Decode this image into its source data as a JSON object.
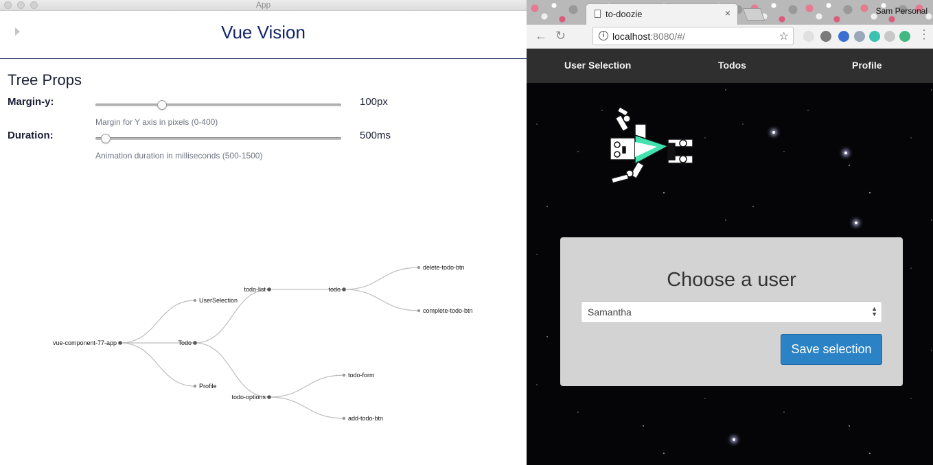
{
  "left_window": {
    "title": "App",
    "app_title": "Vue Vision",
    "section_title": "Tree Props",
    "props": [
      {
        "label": "Margin-y:",
        "value": "100px",
        "help": "Margin for Y axis in pixels (0-400)",
        "slider_fraction": 0.25
      },
      {
        "label": "Duration:",
        "value": "500ms",
        "help": "Animation duration in milliseconds (500-1500)",
        "slider_fraction": 0.0
      }
    ],
    "tree_nodes": {
      "root": "vue-component-77-app",
      "user_selection": "UserSelection",
      "todo": "Todo",
      "profile": "Profile",
      "todo_list": "todo-list",
      "todo_options": "todo-options",
      "todo_item": "todo",
      "delete_btn": "delete-todo-btn",
      "complete_btn": "complete-todo-btn",
      "todo_form": "todo-form",
      "add_btn": "add-todo-btn"
    }
  },
  "browser": {
    "tab_title": "to-doozie",
    "tab_close": "×",
    "profile_name": "Sam Personal",
    "url_host": "localhost",
    "url_rest": ":8080/#/",
    "nav_back": "←",
    "nav_reload": "↻",
    "star": "☆",
    "info": "i",
    "extension_colors": [
      "#e0e0e0",
      "#7a7a7a",
      "#3b6fd1",
      "#9aa7b8",
      "#39c2b0",
      "#c8c8c8",
      "#42b883"
    ],
    "navbar": {
      "links": [
        "User Selection",
        "Todos",
        "Profile"
      ]
    },
    "card": {
      "title": "Choose a user",
      "selected_user": "Samantha",
      "select_arrows": "▲▼",
      "save_label": "Save selection"
    },
    "colors": {
      "accent_button": "#2b82c4",
      "vue_green": "#41e2b0",
      "navbar": "#2f2f2f"
    }
  }
}
